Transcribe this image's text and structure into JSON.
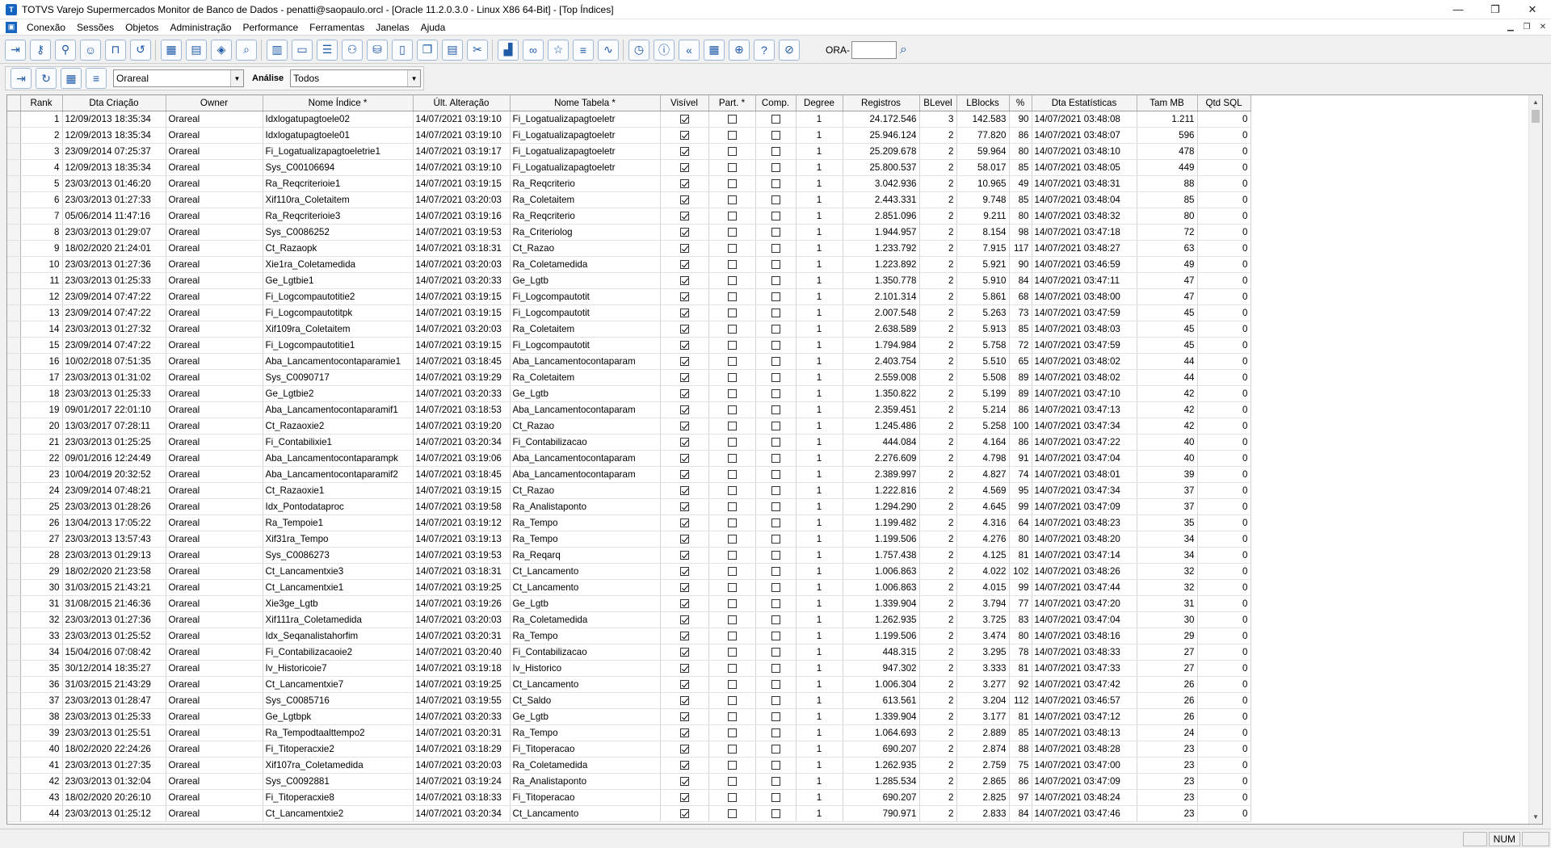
{
  "window": {
    "title": "TOTVS Varejo Supermercados Monitor de Banco de Dados - penatti@saopaulo.orcl - [Oracle 11.2.0.3.0 - Linux X86 64-Bit] - [Top Índices]",
    "minimize": "—",
    "maximize": "❐",
    "close": "✕"
  },
  "menu": {
    "items": [
      "Conexão",
      "Sessões",
      "Objetos",
      "Administração",
      "Performance",
      "Ferramentas",
      "Janelas",
      "Ajuda"
    ]
  },
  "toolbar": {
    "ora_label": "ORA-",
    "ora_value": "",
    "buttons": [
      "exit-icon",
      "key-icon",
      "key-search-icon",
      "user-icon",
      "lock-icon",
      "history-icon",
      "calendar-icon",
      "calendar-config-icon",
      "box-icon",
      "magnifier-icon",
      "report-icon",
      "storage-icon",
      "tuning-icon",
      "users-icon",
      "database-icon",
      "document-icon",
      "documents-icon",
      "page-icon",
      "sql-icon",
      "chart-icon",
      "link-icon",
      "star-icon",
      "list-icon",
      "pulse-icon",
      "clock-icon",
      "info-icon",
      "rewind-icon",
      "calculator-icon",
      "globe-icon",
      "help-icon",
      "stop-icon"
    ]
  },
  "filters": {
    "owner_value": "Orareal",
    "analise_label": "Análise",
    "analise_value": "Todos"
  },
  "grid": {
    "columns": [
      "Rank",
      "Dta Criação",
      "Owner",
      "Nome Índice *",
      "Últ. Alteração",
      "Nome Tabela *",
      "Visível",
      "Part. *",
      "Comp.",
      "Degree",
      "Registros",
      "BLevel",
      "LBlocks",
      "%",
      "Dta Estatísticas",
      "Tam MB",
      "Qtd SQL"
    ],
    "rows": [
      [
        "1",
        "12/09/2013 18:35:34",
        "Orareal",
        "Idxlogatupagtoele02",
        "14/07/2021 03:19:10",
        "Fi_Logatualizapagtoeletr",
        true,
        false,
        false,
        "1",
        "24.172.546",
        "3",
        "142.583",
        "90",
        "14/07/2021 03:48:08",
        "1.211",
        "0"
      ],
      [
        "2",
        "12/09/2013 18:35:34",
        "Orareal",
        "Idxlogatupagtoele01",
        "14/07/2021 03:19:10",
        "Fi_Logatualizapagtoeletr",
        true,
        false,
        false,
        "1",
        "25.946.124",
        "2",
        "77.820",
        "86",
        "14/07/2021 03:48:07",
        "596",
        "0"
      ],
      [
        "3",
        "23/09/2014 07:25:37",
        "Orareal",
        "Fi_Logatualizapagtoeletrie1",
        "14/07/2021 03:19:17",
        "Fi_Logatualizapagtoeletr",
        true,
        false,
        false,
        "1",
        "25.209.678",
        "2",
        "59.964",
        "80",
        "14/07/2021 03:48:10",
        "478",
        "0"
      ],
      [
        "4",
        "12/09/2013 18:35:34",
        "Orareal",
        "Sys_C00106694",
        "14/07/2021 03:19:10",
        "Fi_Logatualizapagtoeletr",
        true,
        false,
        false,
        "1",
        "25.800.537",
        "2",
        "58.017",
        "85",
        "14/07/2021 03:48:05",
        "449",
        "0"
      ],
      [
        "5",
        "23/03/2013 01:46:20",
        "Orareal",
        "Ra_Reqcriterioie1",
        "14/07/2021 03:19:15",
        "Ra_Reqcriterio",
        true,
        false,
        false,
        "1",
        "3.042.936",
        "2",
        "10.965",
        "49",
        "14/07/2021 03:48:31",
        "88",
        "0"
      ],
      [
        "6",
        "23/03/2013 01:27:33",
        "Orareal",
        "Xif110ra_Coletaitem",
        "14/07/2021 03:20:03",
        "Ra_Coletaitem",
        true,
        false,
        false,
        "1",
        "2.443.331",
        "2",
        "9.748",
        "85",
        "14/07/2021 03:48:04",
        "85",
        "0"
      ],
      [
        "7",
        "05/06/2014 11:47:16",
        "Orareal",
        "Ra_Reqcriterioie3",
        "14/07/2021 03:19:16",
        "Ra_Reqcriterio",
        true,
        false,
        false,
        "1",
        "2.851.096",
        "2",
        "9.211",
        "80",
        "14/07/2021 03:48:32",
        "80",
        "0"
      ],
      [
        "8",
        "23/03/2013 01:29:07",
        "Orareal",
        "Sys_C0086252",
        "14/07/2021 03:19:53",
        "Ra_Criteriolog",
        true,
        false,
        false,
        "1",
        "1.944.957",
        "2",
        "8.154",
        "98",
        "14/07/2021 03:47:18",
        "72",
        "0"
      ],
      [
        "9",
        "18/02/2020 21:24:01",
        "Orareal",
        "Ct_Razaopk",
        "14/07/2021 03:18:31",
        "Ct_Razao",
        true,
        false,
        false,
        "1",
        "1.233.792",
        "2",
        "7.915",
        "117",
        "14/07/2021 03:48:27",
        "63",
        "0"
      ],
      [
        "10",
        "23/03/2013 01:27:36",
        "Orareal",
        "Xie1ra_Coletamedida",
        "14/07/2021 03:20:03",
        "Ra_Coletamedida",
        true,
        false,
        false,
        "1",
        "1.223.892",
        "2",
        "5.921",
        "90",
        "14/07/2021 03:46:59",
        "49",
        "0"
      ],
      [
        "11",
        "23/03/2013 01:25:33",
        "Orareal",
        "Ge_Lgtbie1",
        "14/07/2021 03:20:33",
        "Ge_Lgtb",
        true,
        false,
        false,
        "1",
        "1.350.778",
        "2",
        "5.910",
        "84",
        "14/07/2021 03:47:11",
        "47",
        "0"
      ],
      [
        "12",
        "23/09/2014 07:47:22",
        "Orareal",
        "Fi_Logcompautotitie2",
        "14/07/2021 03:19:15",
        "Fi_Logcompautotit",
        true,
        false,
        false,
        "1",
        "2.101.314",
        "2",
        "5.861",
        "68",
        "14/07/2021 03:48:00",
        "47",
        "0"
      ],
      [
        "13",
        "23/09/2014 07:47:22",
        "Orareal",
        "Fi_Logcompautotitpk",
        "14/07/2021 03:19:15",
        "Fi_Logcompautotit",
        true,
        false,
        false,
        "1",
        "2.007.548",
        "2",
        "5.263",
        "73",
        "14/07/2021 03:47:59",
        "45",
        "0"
      ],
      [
        "14",
        "23/03/2013 01:27:32",
        "Orareal",
        "Xif109ra_Coletaitem",
        "14/07/2021 03:20:03",
        "Ra_Coletaitem",
        true,
        false,
        false,
        "1",
        "2.638.589",
        "2",
        "5.913",
        "85",
        "14/07/2021 03:48:03",
        "45",
        "0"
      ],
      [
        "15",
        "23/09/2014 07:47:22",
        "Orareal",
        "Fi_Logcompautotitie1",
        "14/07/2021 03:19:15",
        "Fi_Logcompautotit",
        true,
        false,
        false,
        "1",
        "1.794.984",
        "2",
        "5.758",
        "72",
        "14/07/2021 03:47:59",
        "45",
        "0"
      ],
      [
        "16",
        "10/02/2018 07:51:35",
        "Orareal",
        "Aba_Lancamentocontaparamie1",
        "14/07/2021 03:18:45",
        "Aba_Lancamentocontaparam",
        true,
        false,
        false,
        "1",
        "2.403.754",
        "2",
        "5.510",
        "65",
        "14/07/2021 03:48:02",
        "44",
        "0"
      ],
      [
        "17",
        "23/03/2013 01:31:02",
        "Orareal",
        "Sys_C0090717",
        "14/07/2021 03:19:29",
        "Ra_Coletaitem",
        true,
        false,
        false,
        "1",
        "2.559.008",
        "2",
        "5.508",
        "89",
        "14/07/2021 03:48:02",
        "44",
        "0"
      ],
      [
        "18",
        "23/03/2013 01:25:33",
        "Orareal",
        "Ge_Lgtbie2",
        "14/07/2021 03:20:33",
        "Ge_Lgtb",
        true,
        false,
        false,
        "1",
        "1.350.822",
        "2",
        "5.199",
        "89",
        "14/07/2021 03:47:10",
        "42",
        "0"
      ],
      [
        "19",
        "09/01/2017 22:01:10",
        "Orareal",
        "Aba_Lancamentocontaparamif1",
        "14/07/2021 03:18:53",
        "Aba_Lancamentocontaparam",
        true,
        false,
        false,
        "1",
        "2.359.451",
        "2",
        "5.214",
        "86",
        "14/07/2021 03:47:13",
        "42",
        "0"
      ],
      [
        "20",
        "13/03/2017 07:28:11",
        "Orareal",
        "Ct_Razaoxie2",
        "14/07/2021 03:19:20",
        "Ct_Razao",
        true,
        false,
        false,
        "1",
        "1.245.486",
        "2",
        "5.258",
        "100",
        "14/07/2021 03:47:34",
        "42",
        "0"
      ],
      [
        "21",
        "23/03/2013 01:25:25",
        "Orareal",
        "Fi_Contabilixie1",
        "14/07/2021 03:20:34",
        "Fi_Contabilizacao",
        true,
        false,
        false,
        "1",
        "444.084",
        "2",
        "4.164",
        "86",
        "14/07/2021 03:47:22",
        "40",
        "0"
      ],
      [
        "22",
        "09/01/2016 12:24:49",
        "Orareal",
        "Aba_Lancamentocontaparampk",
        "14/07/2021 03:19:06",
        "Aba_Lancamentocontaparam",
        true,
        false,
        false,
        "1",
        "2.276.609",
        "2",
        "4.798",
        "91",
        "14/07/2021 03:47:04",
        "40",
        "0"
      ],
      [
        "23",
        "10/04/2019 20:32:52",
        "Orareal",
        "Aba_Lancamentocontaparamif2",
        "14/07/2021 03:18:45",
        "Aba_Lancamentocontaparam",
        true,
        false,
        false,
        "1",
        "2.389.997",
        "2",
        "4.827",
        "74",
        "14/07/2021 03:48:01",
        "39",
        "0"
      ],
      [
        "24",
        "23/09/2014 07:48:21",
        "Orareal",
        "Ct_Razaoxie1",
        "14/07/2021 03:19:15",
        "Ct_Razao",
        true,
        false,
        false,
        "1",
        "1.222.816",
        "2",
        "4.569",
        "95",
        "14/07/2021 03:47:34",
        "37",
        "0"
      ],
      [
        "25",
        "23/03/2013 01:28:26",
        "Orareal",
        "Idx_Pontodataproc",
        "14/07/2021 03:19:58",
        "Ra_Analistaponto",
        true,
        false,
        false,
        "1",
        "1.294.290",
        "2",
        "4.645",
        "99",
        "14/07/2021 03:47:09",
        "37",
        "0"
      ],
      [
        "26",
        "13/04/2013 17:05:22",
        "Orareal",
        "Ra_Tempoie1",
        "14/07/2021 03:19:12",
        "Ra_Tempo",
        true,
        false,
        false,
        "1",
        "1.199.482",
        "2",
        "4.316",
        "64",
        "14/07/2021 03:48:23",
        "35",
        "0"
      ],
      [
        "27",
        "23/03/2013 13:57:43",
        "Orareal",
        "Xif31ra_Tempo",
        "14/07/2021 03:19:13",
        "Ra_Tempo",
        true,
        false,
        false,
        "1",
        "1.199.506",
        "2",
        "4.276",
        "80",
        "14/07/2021 03:48:20",
        "34",
        "0"
      ],
      [
        "28",
        "23/03/2013 01:29:13",
        "Orareal",
        "Sys_C0086273",
        "14/07/2021 03:19:53",
        "Ra_Reqarq",
        true,
        false,
        false,
        "1",
        "1.757.438",
        "2",
        "4.125",
        "81",
        "14/07/2021 03:47:14",
        "34",
        "0"
      ],
      [
        "29",
        "18/02/2020 21:23:58",
        "Orareal",
        "Ct_Lancamentxie3",
        "14/07/2021 03:18:31",
        "Ct_Lancamento",
        true,
        false,
        false,
        "1",
        "1.006.863",
        "2",
        "4.022",
        "102",
        "14/07/2021 03:48:26",
        "32",
        "0"
      ],
      [
        "30",
        "31/03/2015 21:43:21",
        "Orareal",
        "Ct_Lancamentxie1",
        "14/07/2021 03:19:25",
        "Ct_Lancamento",
        true,
        false,
        false,
        "1",
        "1.006.863",
        "2",
        "4.015",
        "99",
        "14/07/2021 03:47:44",
        "32",
        "0"
      ],
      [
        "31",
        "31/08/2015 21:46:36",
        "Orareal",
        "Xie3ge_Lgtb",
        "14/07/2021 03:19:26",
        "Ge_Lgtb",
        true,
        false,
        false,
        "1",
        "1.339.904",
        "2",
        "3.794",
        "77",
        "14/07/2021 03:47:20",
        "31",
        "0"
      ],
      [
        "32",
        "23/03/2013 01:27:36",
        "Orareal",
        "Xif111ra_Coletamedida",
        "14/07/2021 03:20:03",
        "Ra_Coletamedida",
        true,
        false,
        false,
        "1",
        "1.262.935",
        "2",
        "3.725",
        "83",
        "14/07/2021 03:47:04",
        "30",
        "0"
      ],
      [
        "33",
        "23/03/2013 01:25:52",
        "Orareal",
        "Idx_Seqanalistahorfim",
        "14/07/2021 03:20:31",
        "Ra_Tempo",
        true,
        false,
        false,
        "1",
        "1.199.506",
        "2",
        "3.474",
        "80",
        "14/07/2021 03:48:16",
        "29",
        "0"
      ],
      [
        "34",
        "15/04/2016 07:08:42",
        "Orareal",
        "Fi_Contabilizacaoie2",
        "14/07/2021 03:20:40",
        "Fi_Contabilizacao",
        true,
        false,
        false,
        "1",
        "448.315",
        "2",
        "3.295",
        "78",
        "14/07/2021 03:48:33",
        "27",
        "0"
      ],
      [
        "35",
        "30/12/2014 18:35:27",
        "Orareal",
        "Iv_Historicoie7",
        "14/07/2021 03:19:18",
        "Iv_Historico",
        true,
        false,
        false,
        "1",
        "947.302",
        "2",
        "3.333",
        "81",
        "14/07/2021 03:47:33",
        "27",
        "0"
      ],
      [
        "36",
        "31/03/2015 21:43:29",
        "Orareal",
        "Ct_Lancamentxie7",
        "14/07/2021 03:19:25",
        "Ct_Lancamento",
        true,
        false,
        false,
        "1",
        "1.006.304",
        "2",
        "3.277",
        "92",
        "14/07/2021 03:47:42",
        "26",
        "0"
      ],
      [
        "37",
        "23/03/2013 01:28:47",
        "Orareal",
        "Sys_C0085716",
        "14/07/2021 03:19:55",
        "Ct_Saldo",
        true,
        false,
        false,
        "1",
        "613.561",
        "2",
        "3.204",
        "112",
        "14/07/2021 03:46:57",
        "26",
        "0"
      ],
      [
        "38",
        "23/03/2013 01:25:33",
        "Orareal",
        "Ge_Lgtbpk",
        "14/07/2021 03:20:33",
        "Ge_Lgtb",
        true,
        false,
        false,
        "1",
        "1.339.904",
        "2",
        "3.177",
        "81",
        "14/07/2021 03:47:12",
        "26",
        "0"
      ],
      [
        "39",
        "23/03/2013 01:25:51",
        "Orareal",
        "Ra_Tempodtaalttempo2",
        "14/07/2021 03:20:31",
        "Ra_Tempo",
        true,
        false,
        false,
        "1",
        "1.064.693",
        "2",
        "2.889",
        "85",
        "14/07/2021 03:48:13",
        "24",
        "0"
      ],
      [
        "40",
        "18/02/2020 22:24:26",
        "Orareal",
        "Fi_Titoperacxie2",
        "14/07/2021 03:18:29",
        "Fi_Titoperacao",
        true,
        false,
        false,
        "1",
        "690.207",
        "2",
        "2.874",
        "88",
        "14/07/2021 03:48:28",
        "23",
        "0"
      ],
      [
        "41",
        "23/03/2013 01:27:35",
        "Orareal",
        "Xif107ra_Coletamedida",
        "14/07/2021 03:20:03",
        "Ra_Coletamedida",
        true,
        false,
        false,
        "1",
        "1.262.935",
        "2",
        "2.759",
        "75",
        "14/07/2021 03:47:00",
        "23",
        "0"
      ],
      [
        "42",
        "23/03/2013 01:32:04",
        "Orareal",
        "Sys_C0092881",
        "14/07/2021 03:19:24",
        "Ra_Analistaponto",
        true,
        false,
        false,
        "1",
        "1.285.534",
        "2",
        "2.865",
        "86",
        "14/07/2021 03:47:09",
        "23",
        "0"
      ],
      [
        "43",
        "18/02/2020 20:26:10",
        "Orareal",
        "Fi_Titoperacxie8",
        "14/07/2021 03:18:33",
        "Fi_Titoperacao",
        true,
        false,
        false,
        "1",
        "690.207",
        "2",
        "2.825",
        "97",
        "14/07/2021 03:48:24",
        "23",
        "0"
      ],
      [
        "44",
        "23/03/2013 01:25:12",
        "Orareal",
        "Ct_Lancamentxie2",
        "14/07/2021 03:20:34",
        "Ct_Lancamento",
        true,
        false,
        false,
        "1",
        "790.971",
        "2",
        "2.833",
        "84",
        "14/07/2021 03:47:46",
        "23",
        "0"
      ]
    ]
  },
  "status": {
    "num": "NUM"
  }
}
